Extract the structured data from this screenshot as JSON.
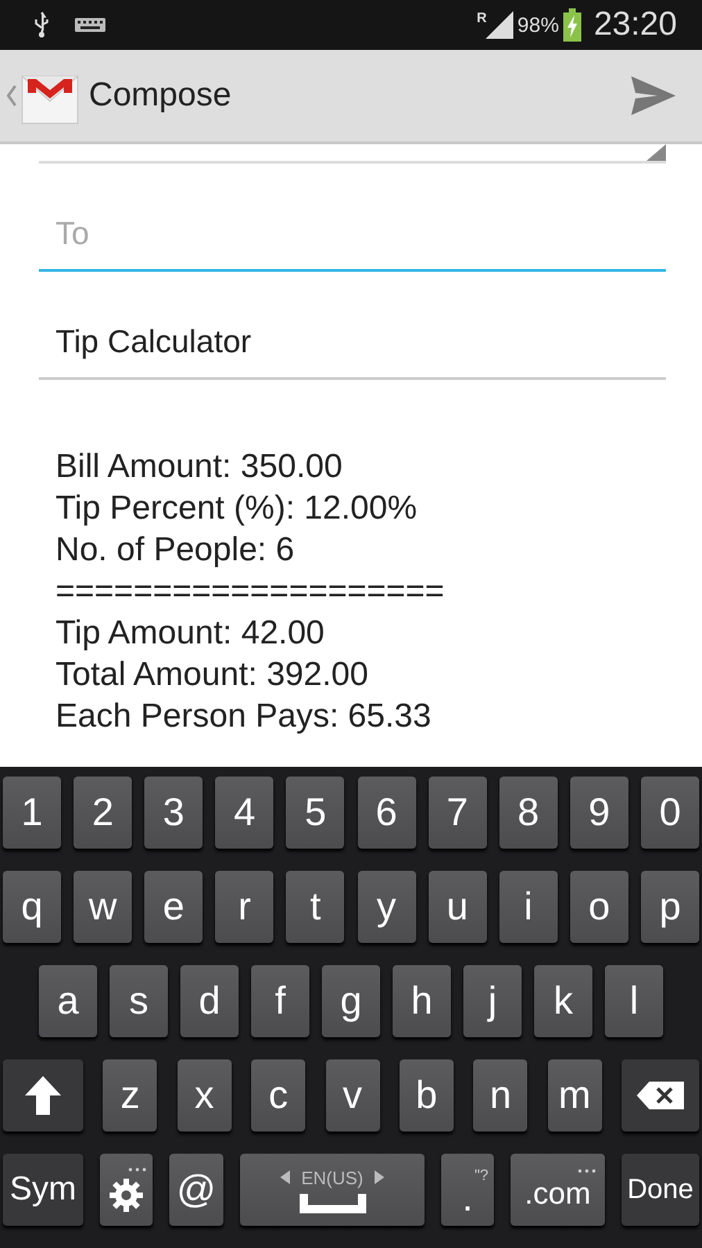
{
  "status_bar": {
    "roaming": "R",
    "battery": "98%",
    "time": "23:20"
  },
  "action_bar": {
    "title": "Compose"
  },
  "to_field": {
    "placeholder": "To",
    "focused": true
  },
  "subject_field": {
    "value": "Tip Calculator"
  },
  "body_lines": [
    "Bill Amount: 350.00",
    "Tip Percent (%): 12.00%",
    "No. of People: 6",
    "====================",
    "Tip Amount: 42.00",
    "Total Amount: 392.00",
    "Each Person Pays: 65.33"
  ],
  "keyboard": {
    "number_row": [
      {
        "kind": "char",
        "label": "1"
      },
      {
        "kind": "char",
        "label": "2"
      },
      {
        "kind": "char",
        "label": "3"
      },
      {
        "kind": "char",
        "label": "4"
      },
      {
        "kind": "char",
        "label": "5"
      },
      {
        "kind": "char",
        "label": "6"
      },
      {
        "kind": "char",
        "label": "7"
      },
      {
        "kind": "char",
        "label": "8"
      },
      {
        "kind": "char",
        "label": "9"
      },
      {
        "kind": "char",
        "label": "0"
      }
    ],
    "top_letter_row": [
      {
        "kind": "char",
        "label": "q"
      },
      {
        "kind": "char",
        "label": "w"
      },
      {
        "kind": "char",
        "label": "e"
      },
      {
        "kind": "char",
        "label": "r"
      },
      {
        "kind": "char",
        "label": "t"
      },
      {
        "kind": "char",
        "label": "y"
      },
      {
        "kind": "char",
        "label": "u"
      },
      {
        "kind": "char",
        "label": "i"
      },
      {
        "kind": "char",
        "label": "o"
      },
      {
        "kind": "char",
        "label": "p"
      }
    ],
    "middle_letter_row": [
      {
        "kind": "char",
        "label": "a"
      },
      {
        "kind": "char",
        "label": "s"
      },
      {
        "kind": "char",
        "label": "d"
      },
      {
        "kind": "char",
        "label": "f"
      },
      {
        "kind": "char",
        "label": "g"
      },
      {
        "kind": "char",
        "label": "h"
      },
      {
        "kind": "char",
        "label": "j"
      },
      {
        "kind": "char",
        "label": "k"
      },
      {
        "kind": "char",
        "label": "l"
      }
    ],
    "bottom_letter_row": [
      {
        "kind": "shift"
      },
      {
        "kind": "char",
        "label": "z"
      },
      {
        "kind": "char",
        "label": "x"
      },
      {
        "kind": "char",
        "label": "c"
      },
      {
        "kind": "char",
        "label": "v"
      },
      {
        "kind": "char",
        "label": "b"
      },
      {
        "kind": "char",
        "label": "n"
      },
      {
        "kind": "char",
        "label": "m"
      },
      {
        "kind": "backspace"
      }
    ],
    "function_row": [
      {
        "kind": "sym",
        "label": "Sym"
      },
      {
        "kind": "settings"
      },
      {
        "kind": "at",
        "label": "@"
      },
      {
        "kind": "space",
        "label": "EN(US)"
      },
      {
        "kind": "period",
        "label": ".",
        "hint": "\"?"
      },
      {
        "kind": "com",
        "label": ".com"
      },
      {
        "kind": "done",
        "label": "Done"
      }
    ]
  }
}
